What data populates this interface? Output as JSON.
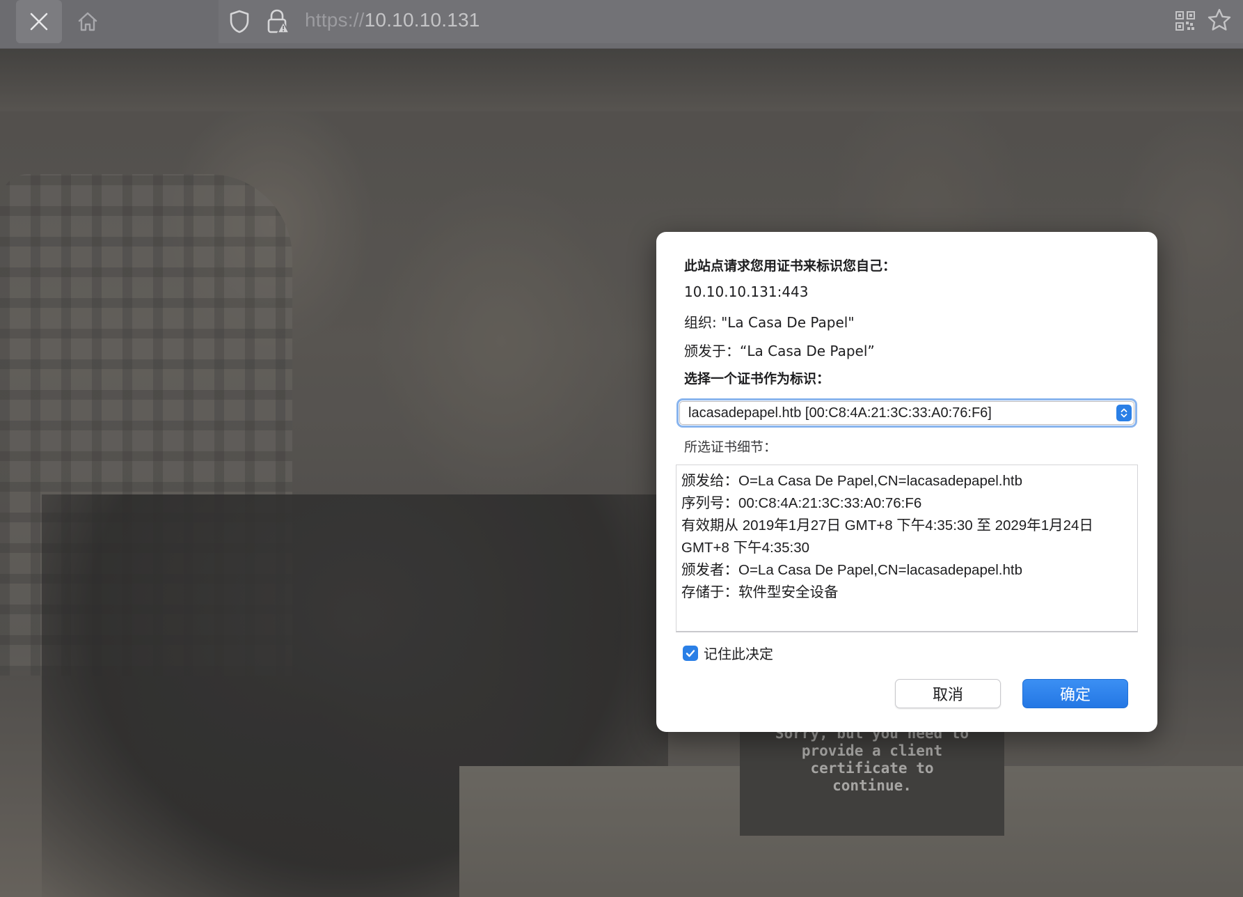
{
  "browser": {
    "url_protocol": "https://",
    "url_host": "10.10.10.131",
    "icons": [
      "close-icon",
      "home-icon",
      "shield-icon",
      "lock-warning-icon",
      "qr-code-icon",
      "star-icon"
    ]
  },
  "page": {
    "message": "Sorry, but you need to provide a client certificate to continue."
  },
  "dialog": {
    "heading": "此站点请求您用证书来标识您自己：",
    "host": "10.10.10.131:443",
    "organization": "组织: \"La Casa De Papel\"",
    "issued_under": "颁发于：“La Casa De Papel”",
    "choose_label": "选择一个证书作为标识：",
    "selected_certificate": "lacasadepapel.htb [00:C8:4A:21:3C:33:A0:76:F6]",
    "details_label": "所选证书细节：",
    "details": {
      "issued_to": "颁发给：O=La Casa De Papel,CN=lacasadepapel.htb",
      "serial": "序列号：00:C8:4A:21:3C:33:A0:76:F6",
      "validity": "有效期从 2019年1月27日 GMT+8 下午4:35:30 至 2029年1月24日 GMT+8 下午4:35:30",
      "issuer": "颁发者：O=La Casa De Papel,CN=lacasadepapel.htb",
      "stored_on": "存储于：软件型安全设备"
    },
    "remember_label": "记住此决定",
    "remember_checked": true,
    "cancel_label": "取消",
    "ok_label": "确定",
    "accent_color": "#2a7fe6"
  }
}
